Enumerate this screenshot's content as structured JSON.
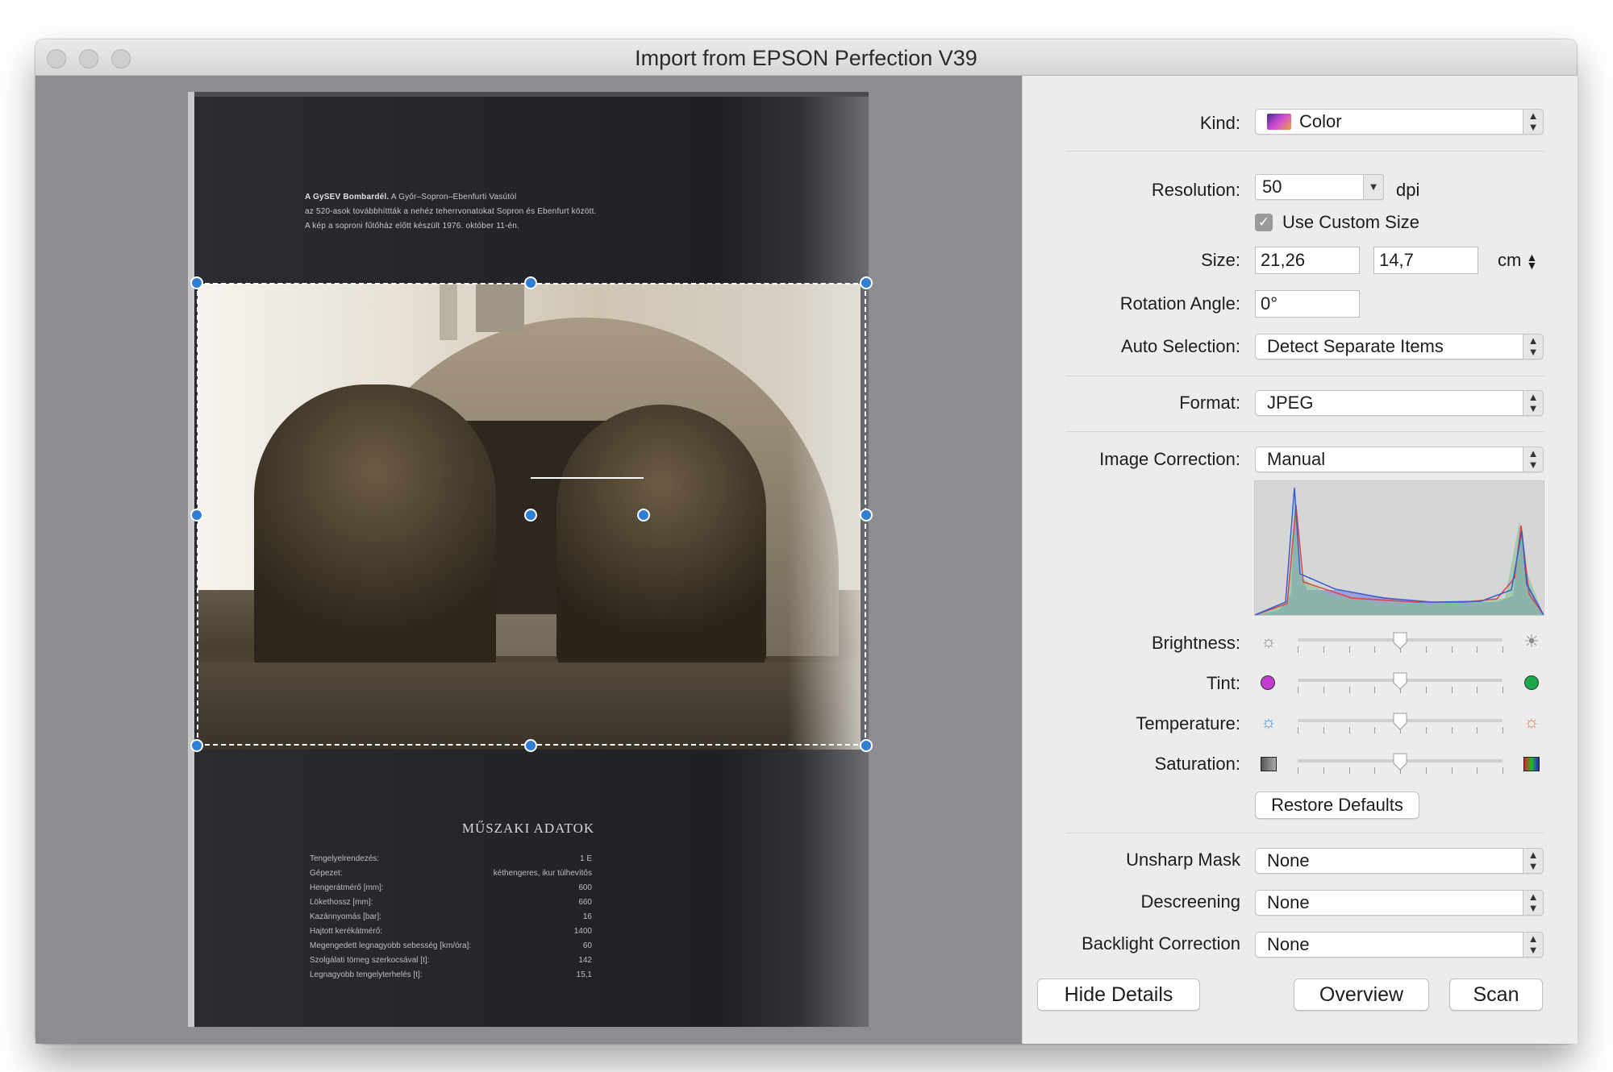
{
  "window": {
    "title": "Import from EPSON Perfection V39"
  },
  "preview": {
    "caption_bold": "A GySEV Bombardél.",
    "caption_lines": [
      "A Győr–Sopron–Ebenfurti Vasútól",
      "az 520-asok továbbhíttták a nehéz teherrvonatokat Sopron és Ebenfurt között.",
      "A kép a soproni fűtőház előtt készült 1976. október 11-én."
    ],
    "tech_title": "MŰSZAKI ADATOK",
    "tech_rows": [
      {
        "k": "Tengelyelrendezés:",
        "v": "1 E"
      },
      {
        "k": "Gépezet:",
        "v": "kéthengeres, ikur túlhevítős"
      },
      {
        "k": "Hengerátmérő [mm]:",
        "v": "600"
      },
      {
        "k": "Lökethossz [mm]:",
        "v": "660"
      },
      {
        "k": "Kazánnyomás [bar]:",
        "v": "16"
      },
      {
        "k": "Hajtott kerékátmérő:",
        "v": "1400"
      },
      {
        "k": "Megengedett legnagyobb sebesség [km/óra]:",
        "v": "60"
      },
      {
        "k": "Szolgálati tömeg szerkocsával [t]:",
        "v": "142"
      },
      {
        "k": "Legnagyobb tengelyterhelés [t]:",
        "v": "15,1"
      }
    ]
  },
  "panel": {
    "kind": {
      "label": "Kind:",
      "value": "Color",
      "icon": "color-swatch-icon"
    },
    "resolution": {
      "label": "Resolution:",
      "value": "50",
      "unit": "dpi"
    },
    "custom_size": {
      "label": "Use Custom Size",
      "checked": true
    },
    "size": {
      "label": "Size:",
      "width": "21,26",
      "height": "14,7",
      "unit": "cm"
    },
    "rotation": {
      "label": "Rotation Angle:",
      "value": "0°"
    },
    "auto_selection": {
      "label": "Auto Selection:",
      "value": "Detect Separate Items"
    },
    "format": {
      "label": "Format:",
      "value": "JPEG"
    },
    "image_correction": {
      "label": "Image Correction:",
      "value": "Manual"
    },
    "sliders": {
      "brightness": {
        "label": "Brightness:",
        "value": 0.5
      },
      "tint": {
        "label": "Tint:",
        "value": 0.5
      },
      "temperature": {
        "label": "Temperature:",
        "value": 0.5
      },
      "saturation": {
        "label": "Saturation:",
        "value": 0.5
      }
    },
    "restore_defaults": "Restore Defaults",
    "unsharp_mask": {
      "label": "Unsharp Mask",
      "value": "None"
    },
    "descreening": {
      "label": "Descreening",
      "value": "None"
    },
    "backlight": {
      "label": "Backlight Correction",
      "value": "None"
    },
    "buttons": {
      "hide_details": "Hide Details",
      "overview": "Overview",
      "scan": "Scan"
    },
    "colors": {
      "accent": "#2f7fd6",
      "tint_left": "#c23ccf",
      "tint_right": "#1aa84a"
    }
  }
}
